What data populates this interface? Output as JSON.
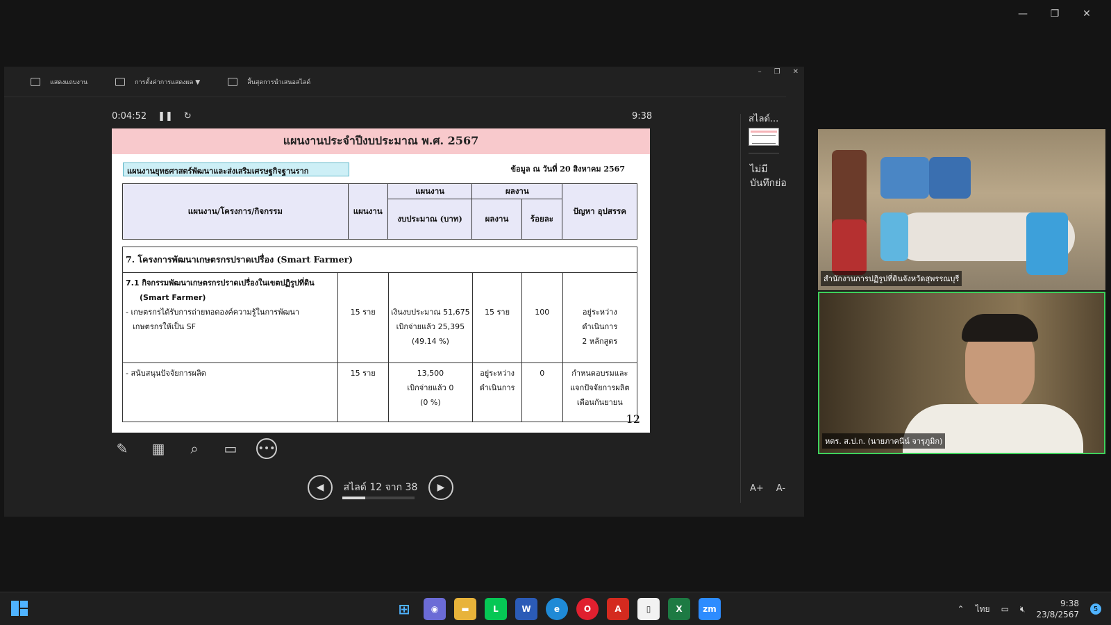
{
  "presenter": {
    "toolbar": {
      "show_taskbar": "แสดงแถบงาน",
      "display_settings": "การตั้งค่าการแสดงผล ▼",
      "end_show": "สิ้นสุดการนำเสนอสไลด์"
    },
    "elapsed": "0:04:52",
    "clock": "9:38",
    "slide": {
      "title": "แผนงานประจำปีงบประมาณ พ.ศ. 2567",
      "plan_label": "แผนงานยุทธศาสตร์พัฒนาและส่งเสริมเศรษฐกิจฐานราก",
      "data_date": "ข้อมูล ณ วันที่ 20 สิงหาคม 2567",
      "headers": {
        "activity": "แผนงาน/โครงการ/กิจกรรม",
        "plan": "แผนงาน",
        "plan_group": "แผนงาน",
        "budget": "งบประมาณ (บาท)",
        "result_group": "ผลงาน",
        "result": "ผลงาน",
        "percent": "ร้อยละ",
        "problems": "ปัญหา อุปสรรค"
      },
      "section_title": "7. โครงการพัฒนาเกษตรกรปราดเปรื่อง (Smart Farmer)",
      "rows": [
        {
          "activity_line1": "7.1 กิจกรรมพัฒนาเกษตรกรปราดเปรื่องในเขตปฏิรูปที่ดิน",
          "activity_line2": "(Smart Farmer)",
          "activity_line3": "- เกษตรกรได้รับการถ่ายทอดองค์ความรู้ในการพัฒนา",
          "activity_line4": "เกษตรกรให้เป็น SF",
          "plan": "15 ราย",
          "budget_line1": "เงินงบประมาณ 51,675",
          "budget_line2": "เบิกจ่ายแล้ว 25,395",
          "budget_line3": "(49.14 %)",
          "result_line1": "15 ราย",
          "result_line2": "",
          "percent": "100",
          "problem_line1": "อยู่ระหว่าง",
          "problem_line2": "ดำเนินการ",
          "problem_line3": "2 หลักสูตร"
        },
        {
          "activity_line1": "- สนับสนุนปัจจัยการผลิต",
          "plan": "15 ราย",
          "budget_line1": "13,500",
          "budget_line2": "เบิกจ่ายแล้ว 0",
          "budget_line3": "(0 %)",
          "result_line1": "อยู่ระหว่าง",
          "result_line2": "ดำเนินการ",
          "percent": "0",
          "problem_line1": "กำหนดอบรมและ",
          "problem_line2": "แจกปัจจัยการผลิต",
          "problem_line3": "เดือนกันยายน"
        }
      ],
      "page_number": "12"
    },
    "nav": {
      "label": "สไลด์ 12 จาก 38",
      "progress": 0.3158
    },
    "notes": {
      "title": "สไลด์...",
      "text": "ไม่มีบันทึกย่อ",
      "font_up": "A+",
      "font_down": "A-"
    }
  },
  "videos": [
    {
      "label": "สำนักงานการปฏิรูปที่ดินจังหวัดสุพรรณบุรี"
    },
    {
      "label": "หตร. ส.ป.ก. (นายภาคนีน์ จารุภูมิก)"
    }
  ],
  "taskbar": {
    "tray_lang": "ไทย",
    "tray_time": "9:38",
    "tray_date": "23/8/2567",
    "notif_count": "5"
  },
  "colors": {
    "slide_title_bg": "#f8c9cc",
    "plan_label_bg": "#cdeff6",
    "header_bg": "#e8e8f8",
    "active_speaker_border": "#3fd25c"
  }
}
